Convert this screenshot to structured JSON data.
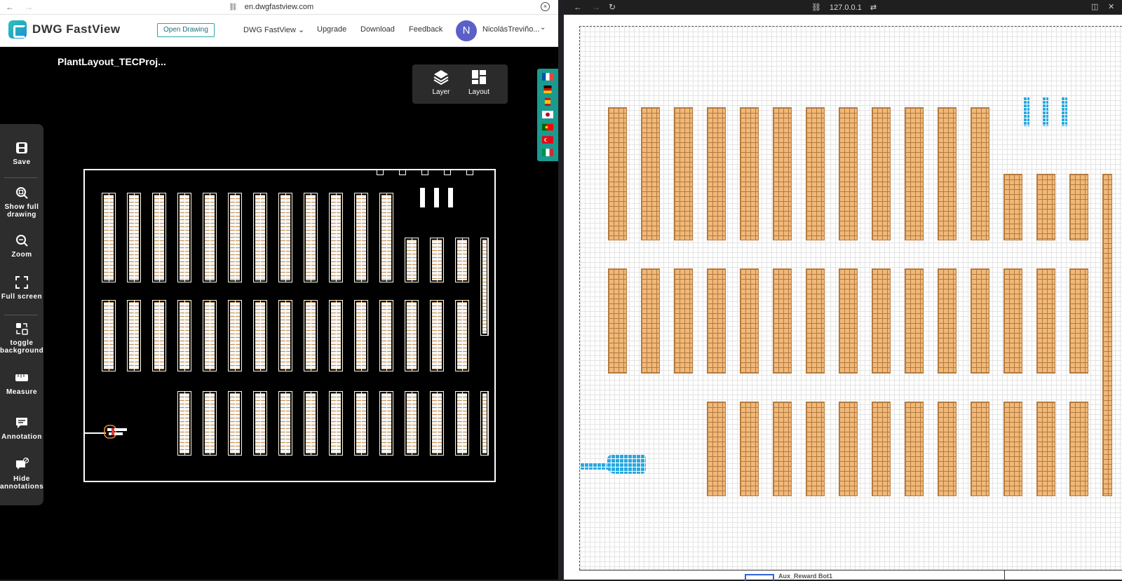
{
  "left_browser": {
    "url": "en.dwgfastview.com",
    "back": "←",
    "forward": "→",
    "close": "×"
  },
  "header": {
    "brand": "DWG FastView",
    "open_drawing": "Open Drawing",
    "menu": {
      "fastview": "DWG FastView",
      "upgrade": "Upgrade",
      "download": "Download",
      "feedback": "Feedback"
    },
    "avatar_initial": "N",
    "username": "NicolásTreviño...",
    "chevron": "⌄"
  },
  "drawing": {
    "file_title": "PlantLayout_TECProj..."
  },
  "view_panel": {
    "layer": "Layer",
    "layout": "Layout"
  },
  "tools": {
    "save": "Save",
    "show_full_drawing": "Show full drawing",
    "zoom": "Zoom",
    "full_screen": "Full screen",
    "toggle_background": "toggle background",
    "measure": "Measure",
    "annotation": "Annotation",
    "hide_annotations": "Hide annotations"
  },
  "flags": [
    "french-flag",
    "german-flag",
    "spanish-flag",
    "japanese-flag",
    "portuguese-flag",
    "turkish-flag",
    "italian-flag"
  ],
  "right_browser": {
    "url": "127.0.0.1",
    "back": "←",
    "forward": "→",
    "reload": "↻"
  },
  "right_canvas": {
    "bottom_label": "Aux_Reward Bot1"
  },
  "colors": {
    "rack_fill": "#f0b879",
    "rack_grid": "#b47a3e",
    "robot_blue": "#29a8e0",
    "flag_bar": "#1a9b8f",
    "avatar": "#5b5fc7"
  }
}
